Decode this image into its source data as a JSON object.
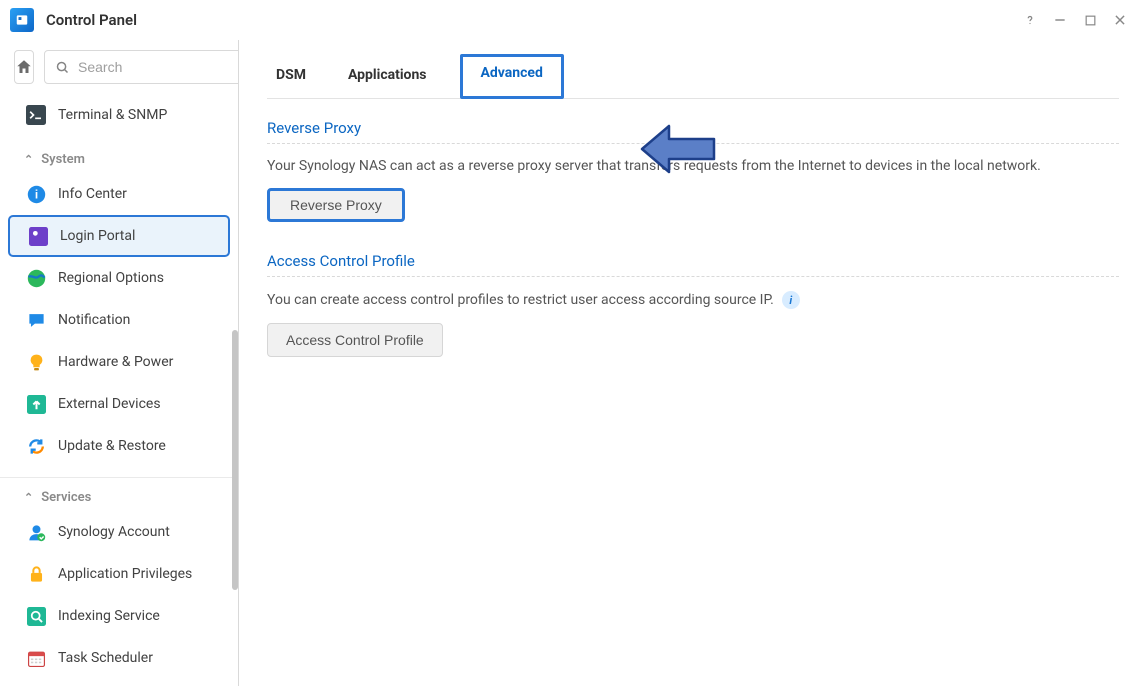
{
  "window": {
    "title": "Control Panel"
  },
  "search": {
    "placeholder": "Search"
  },
  "sidebar_top": [
    {
      "label": "Terminal & SNMP",
      "icon": "terminal-icon"
    }
  ],
  "sections": [
    {
      "name": "System",
      "items": [
        {
          "label": "Info Center",
          "icon": "info-icon",
          "selected": false
        },
        {
          "label": "Login Portal",
          "icon": "portal-icon",
          "selected": true
        },
        {
          "label": "Regional Options",
          "icon": "globe-icon",
          "selected": false
        },
        {
          "label": "Notification",
          "icon": "chat-icon",
          "selected": false
        },
        {
          "label": "Hardware & Power",
          "icon": "bulb-icon",
          "selected": false
        },
        {
          "label": "External Devices",
          "icon": "device-icon",
          "selected": false
        },
        {
          "label": "Update & Restore",
          "icon": "refresh-icon",
          "selected": false
        }
      ]
    },
    {
      "name": "Services",
      "items": [
        {
          "label": "Synology Account",
          "icon": "user-icon",
          "selected": false
        },
        {
          "label": "Application Privileges",
          "icon": "lock-icon",
          "selected": false
        },
        {
          "label": "Indexing Service",
          "icon": "search-file-icon",
          "selected": false
        },
        {
          "label": "Task Scheduler",
          "icon": "calendar-icon",
          "selected": false
        }
      ]
    }
  ],
  "tabs": [
    {
      "label": "DSM",
      "active": false
    },
    {
      "label": "Applications",
      "active": false
    },
    {
      "label": "Advanced",
      "active": true
    }
  ],
  "content": {
    "reverse_proxy_title": "Reverse Proxy",
    "reverse_proxy_desc": "Your Synology NAS can act as a reverse proxy server that transfers requests from the Internet to devices in the local network.",
    "reverse_proxy_btn": "Reverse Proxy",
    "acp_title": "Access Control Profile",
    "acp_desc": "You can create access control profiles to restrict user access according source IP.",
    "acp_btn": "Access Control Profile"
  },
  "colors": {
    "accent": "#2c78d6"
  }
}
